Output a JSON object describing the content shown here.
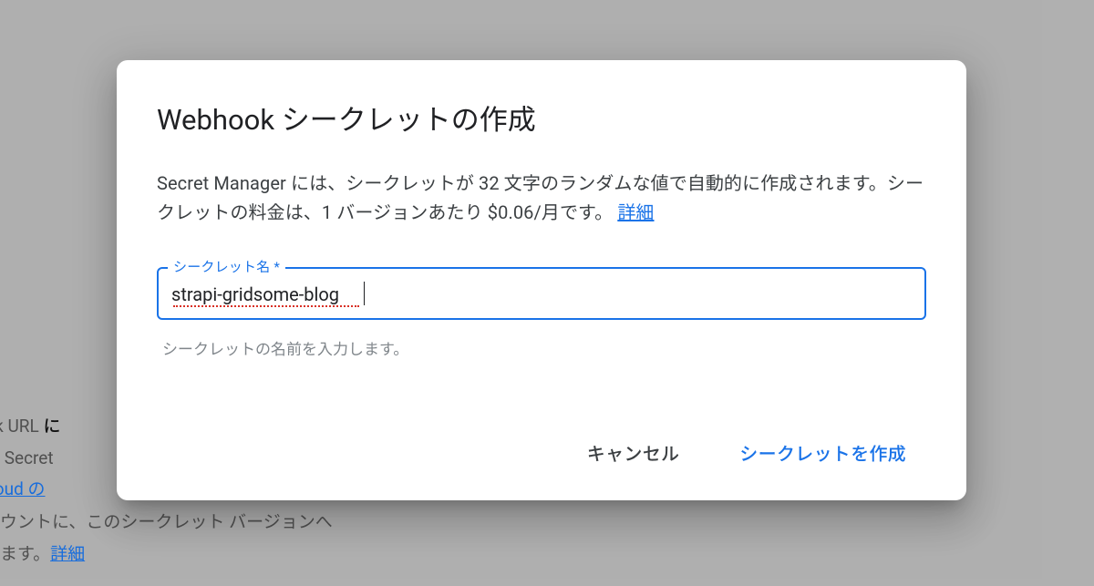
{
  "background": {
    "line1_part1": "hook URL ",
    "line1_label": "に",
    "line2": "いる Secret",
    "line3_link": "e Cloud の",
    "line4": "アカウントに、このシークレット バージョンへ",
    "line5_text": "されます。",
    "line5_link": "詳細"
  },
  "dialog": {
    "title": "Webhook シークレットの作成",
    "description_text": "Secret Manager には、シークレットが 32 文字のランダムな値で自動的に作成されます。シークレットの料金は、1 バージョンあたり $0.06/月です。",
    "description_link": "詳細",
    "field": {
      "label": "シークレット名 *",
      "value": "strapi-gridsome-blog",
      "hint": "シークレットの名前を入力します。"
    },
    "actions": {
      "cancel": "キャンセル",
      "confirm": "シークレットを作成"
    }
  }
}
